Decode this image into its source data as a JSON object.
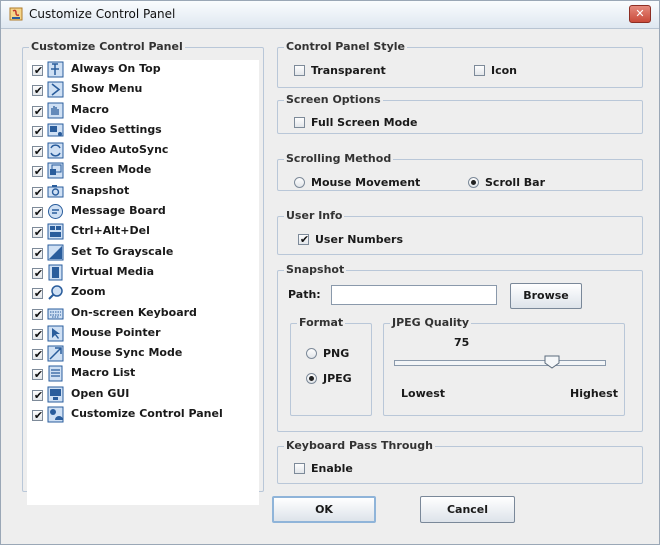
{
  "window": {
    "title": "Customize Control Panel",
    "close_label": "✕"
  },
  "left_panel": {
    "title": "Customize Control Panel",
    "items": [
      {
        "label": "Always On Top",
        "checked": true,
        "icon": "pin-top-icon"
      },
      {
        "label": "Show Menu",
        "checked": true,
        "icon": "chevron-right-icon"
      },
      {
        "label": "Macro",
        "checked": true,
        "icon": "macro-hand-icon"
      },
      {
        "label": "Video Settings",
        "checked": true,
        "icon": "video-settings-icon"
      },
      {
        "label": "Video AutoSync",
        "checked": true,
        "icon": "autosync-icon"
      },
      {
        "label": "Screen Mode",
        "checked": true,
        "icon": "screen-mode-icon"
      },
      {
        "label": "Snapshot",
        "checked": true,
        "icon": "camera-icon"
      },
      {
        "label": "Message Board",
        "checked": true,
        "icon": "message-board-icon"
      },
      {
        "label": "Ctrl+Alt+Del",
        "checked": true,
        "icon": "ctrl-alt-del-icon"
      },
      {
        "label": "Set To Grayscale",
        "checked": true,
        "icon": "grayscale-icon"
      },
      {
        "label": "Virtual Media",
        "checked": true,
        "icon": "virtual-media-icon"
      },
      {
        "label": "Zoom",
        "checked": true,
        "icon": "zoom-icon"
      },
      {
        "label": "On-screen Keyboard",
        "checked": true,
        "icon": "keyboard-icon"
      },
      {
        "label": "Mouse Pointer",
        "checked": true,
        "icon": "mouse-pointer-icon"
      },
      {
        "label": "Mouse Sync Mode",
        "checked": true,
        "icon": "mouse-sync-icon"
      },
      {
        "label": "Macro List",
        "checked": true,
        "icon": "macro-list-icon"
      },
      {
        "label": "Open GUI",
        "checked": true,
        "icon": "open-gui-icon"
      },
      {
        "label": "Customize Control Panel",
        "checked": true,
        "icon": "customize-icon"
      }
    ]
  },
  "control_panel_style": {
    "title": "Control Panel Style",
    "transparent": {
      "label": "Transparent",
      "checked": false
    },
    "icon": {
      "label": "Icon",
      "checked": false
    }
  },
  "screen_options": {
    "title": "Screen Options",
    "full_screen": {
      "label": "Full Screen Mode",
      "checked": false
    }
  },
  "scrolling_method": {
    "title": "Scrolling Method",
    "mouse_movement": {
      "label": "Mouse Movement",
      "selected": false
    },
    "scroll_bar": {
      "label": "Scroll Bar",
      "selected": true
    }
  },
  "user_info": {
    "title": "User Info",
    "user_numbers": {
      "label": "User Numbers",
      "checked": true
    }
  },
  "snapshot": {
    "title": "Snapshot",
    "path_label": "Path:",
    "path_value": "",
    "browse_label": "Browse",
    "format": {
      "title": "Format",
      "png": {
        "label": "PNG",
        "selected": false
      },
      "jpeg": {
        "label": "JPEG",
        "selected": true
      }
    },
    "jpeg_quality": {
      "title": "JPEG Quality",
      "value": "75",
      "min_label": "Lowest",
      "max_label": "Highest",
      "level": 0.75
    }
  },
  "keyboard_pass_through": {
    "title": "Keyboard Pass Through",
    "enable": {
      "label": "Enable",
      "checked": false
    }
  },
  "buttons": {
    "ok": "OK",
    "cancel": "Cancel"
  },
  "colors": {
    "icon_blue": "#2a5d9c",
    "icon_fill": "#cfe0f4",
    "group_border": "#b9c7d8"
  }
}
